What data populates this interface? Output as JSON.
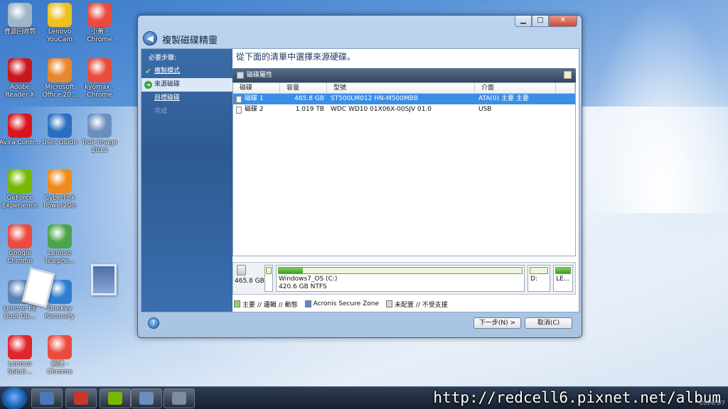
{
  "desktop": {
    "icons": [
      {
        "label": "資源回收筒",
        "color": "#9fb6c8"
      },
      {
        "label": "Lenovo YouCam",
        "color": "#f0c020"
      },
      {
        "label": "小黃 - Chrome",
        "color": "#e94b3c"
      },
      {
        "label": "Adobe Reader X",
        "color": "#c8171d"
      },
      {
        "label": "Microsoft Office 20...",
        "color": "#e8862a"
      },
      {
        "label": "kyomax - Chrome",
        "color": "#e94b3c"
      },
      {
        "label": "Avira Contr...",
        "color": "#d9141c"
      },
      {
        "label": "User Guide",
        "color": "#2a6fc0"
      },
      {
        "label": "True Image 2013",
        "color": "#6a8fbf"
      },
      {
        "label": "GeForce Experience",
        "color": "#76b900"
      },
      {
        "label": "Cyberlink Power2Go",
        "color": "#f08a1a"
      },
      {
        "label": "Google Chrome",
        "color": "#e94b3c"
      },
      {
        "label": "Lenovo Telephe...",
        "color": "#4aa548"
      },
      {
        "label": "Lenovo EE Boot Op...",
        "color": "#5a84b8"
      },
      {
        "label": "OneKey Recovery",
        "color": "#2f7fd0"
      },
      {
        "label": "Lenovo Soluti...",
        "color": "#e0262a"
      },
      {
        "label": "網購 - Chrome",
        "color": "#e94b3c"
      }
    ]
  },
  "window": {
    "title": "複製磁碟精靈",
    "controls": {
      "minimize": "▁",
      "maximize": "□",
      "close": "✕"
    },
    "back_icon": "◀"
  },
  "sidebar": {
    "heading": "必要步驟:",
    "items": [
      {
        "label": "複製模式",
        "state": "done",
        "mark": "✔"
      },
      {
        "label": "來源磁碟",
        "state": "active",
        "mark": "➜"
      },
      {
        "label": "目標磁碟",
        "state": "pending",
        "mark": ""
      },
      {
        "label": "完成",
        "state": "disabled",
        "mark": ""
      }
    ]
  },
  "content": {
    "instruction": "從下面的清單中選擇來源硬碟。",
    "toolbar_label": "磁碟屬性",
    "columns": [
      "磁碟",
      "容量",
      "型號",
      "介面",
      ""
    ],
    "rows": [
      {
        "disk": "磁碟 1",
        "capacity": "465.8 GB",
        "model": "ST500LM012 HN-M500MBB",
        "interface": "ATA(0) 主要 主要",
        "selected": true
      },
      {
        "disk": "磁碟 2",
        "capacity": "1.019 TB",
        "model": "WDC WD10 01X06X-00SJV 01.0",
        "interface": "USB",
        "selected": false
      }
    ],
    "diskmap": {
      "size": "465.8 GB",
      "main_name": "Windows7_OS (C:)",
      "main_detail": "420.6 GB  NTFS",
      "main_fill": 0.1,
      "d_label": "D:",
      "le_label": "LE..."
    },
    "legend": [
      {
        "label": "主要 // 邏輯 // 動態",
        "color": "#8fd468"
      },
      {
        "label": "Acronis Secure Zone",
        "color": "#5a8ad6"
      },
      {
        "label": "未配置 // 不受支援",
        "color": "#d8d8d8"
      }
    ]
  },
  "footer": {
    "help_icon": "?",
    "next_label": "下一步(N) >",
    "cancel_label": "取消(C)"
  },
  "taskbar": {
    "watermark": "http://redcell6.pixnet.net/album",
    "clock": "2014/3/7"
  }
}
